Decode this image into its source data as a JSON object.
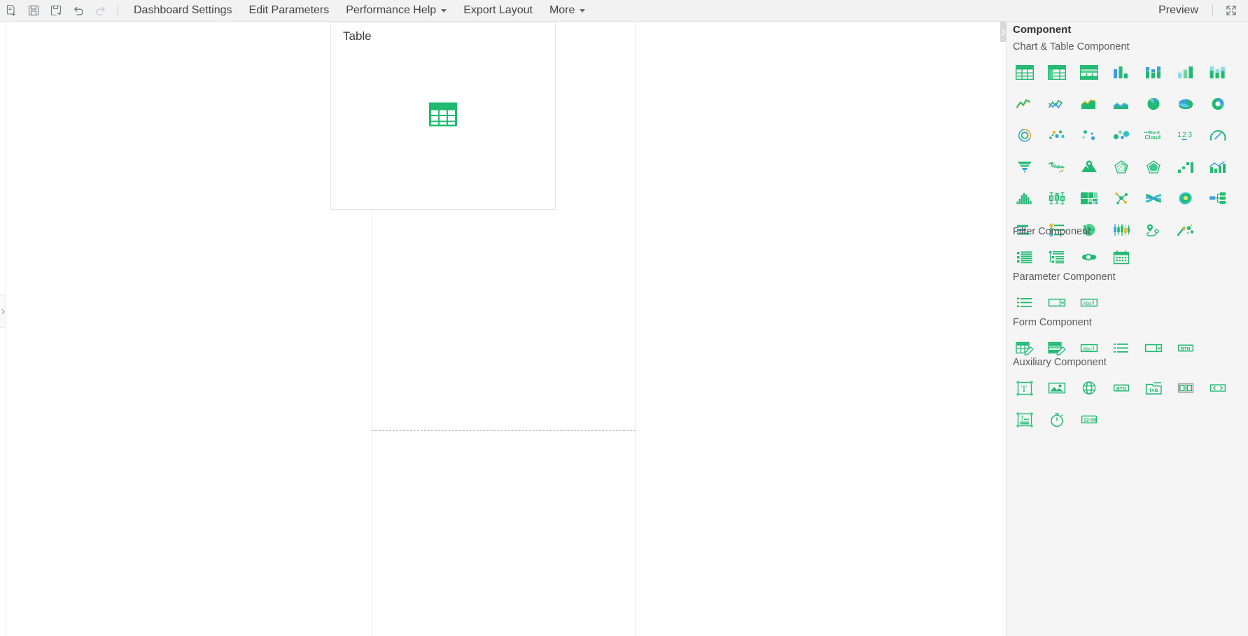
{
  "toolbar": {
    "icons": [
      {
        "name": "new-dashboard-icon",
        "title": "New"
      },
      {
        "name": "save-icon",
        "title": "Save"
      },
      {
        "name": "save-as-icon",
        "title": "Save As"
      },
      {
        "name": "undo-icon",
        "title": "Undo"
      },
      {
        "name": "redo-icon",
        "title": "Redo"
      }
    ],
    "menus": [
      {
        "label": "Dashboard Settings",
        "caret": false
      },
      {
        "label": "Edit Parameters",
        "caret": false
      },
      {
        "label": "Performance Help",
        "caret": true
      },
      {
        "label": "Export Layout",
        "caret": false
      },
      {
        "label": "More",
        "caret": true
      }
    ],
    "preview_label": "Preview",
    "fullscreen_icon": "fullscreen-icon"
  },
  "canvas": {
    "widget": {
      "title": "Table",
      "placeholder_icon": "table-placeholder-icon"
    }
  },
  "panel": {
    "title": "Component",
    "collapse_icon": "chevron-right-icon",
    "sections": [
      {
        "id": "chart",
        "title": "Chart & Table Component",
        "items": [
          {
            "name": "table-icon",
            "label": "Table"
          },
          {
            "name": "cross-table-icon",
            "label": "Cross Table"
          },
          {
            "name": "group-table-icon",
            "label": "Group Table"
          },
          {
            "name": "column-chart-icon",
            "label": "Column Chart"
          },
          {
            "name": "stacked-column-chart-icon",
            "label": "Stacked Column Chart"
          },
          {
            "name": "column-3d-chart-icon",
            "label": "3D Column Chart"
          },
          {
            "name": "stacked-column-3d-chart-icon",
            "label": "3D Stacked Column Chart"
          },
          {
            "name": "line-chart-icon",
            "label": "Line Chart"
          },
          {
            "name": "multi-line-chart-icon",
            "label": "Multi Line Chart"
          },
          {
            "name": "area-chart-icon",
            "label": "Area Chart"
          },
          {
            "name": "stacked-area-chart-icon",
            "label": "Stacked Area Chart"
          },
          {
            "name": "pie-chart-icon",
            "label": "Pie Chart"
          },
          {
            "name": "pie-3d-chart-icon",
            "label": "3D Pie Chart"
          },
          {
            "name": "donut-chart-icon",
            "label": "Donut Chart"
          },
          {
            "name": "ring-progress-icon",
            "label": "Ring Progress"
          },
          {
            "name": "scatter-chart-icon",
            "label": "Scatter Chart"
          },
          {
            "name": "bubble-chart-icon",
            "label": "Bubble Chart"
          },
          {
            "name": "packed-bubble-icon",
            "label": "Packed Bubble"
          },
          {
            "name": "word-cloud-icon",
            "label": "Word Cloud"
          },
          {
            "name": "kpi-number-icon",
            "label": "KPI Number"
          },
          {
            "name": "gauge-chart-icon",
            "label": "Gauge Chart"
          },
          {
            "name": "funnel-chart-icon",
            "label": "Funnel Chart"
          },
          {
            "name": "world-map-icon",
            "label": "World Map"
          },
          {
            "name": "point-map-icon",
            "label": "Point Map"
          },
          {
            "name": "radar-chart-icon",
            "label": "Radar Chart"
          },
          {
            "name": "filled-radar-chart-icon",
            "label": "Filled Radar Chart"
          },
          {
            "name": "waterfall-chart-icon",
            "label": "Waterfall Chart"
          },
          {
            "name": "combo-chart-icon",
            "label": "Combo Chart"
          },
          {
            "name": "histogram-icon",
            "label": "Histogram"
          },
          {
            "name": "box-plot-icon",
            "label": "Box Plot"
          },
          {
            "name": "treemap-icon",
            "label": "Treemap"
          },
          {
            "name": "network-chart-icon",
            "label": "Network Chart"
          },
          {
            "name": "sankey-chart-icon",
            "label": "Sankey Chart"
          },
          {
            "name": "contour-map-icon",
            "label": "Contour Map"
          },
          {
            "name": "org-tree-icon",
            "label": "Org Tree"
          },
          {
            "name": "bar-chart-icon",
            "label": "Bar Chart"
          },
          {
            "name": "bullet-chart-icon",
            "label": "Bullet Chart"
          },
          {
            "name": "globe-map-icon",
            "label": "Globe Map"
          },
          {
            "name": "candlestick-chart-icon",
            "label": "Candlestick Chart"
          },
          {
            "name": "route-map-icon",
            "label": "Route Map"
          },
          {
            "name": "custom-chart-icon",
            "label": "Custom Chart"
          }
        ]
      },
      {
        "id": "filter",
        "title": "Filter Component",
        "items": [
          {
            "name": "list-filter-icon",
            "label": "List Filter"
          },
          {
            "name": "tree-filter-icon",
            "label": "Tree Filter"
          },
          {
            "name": "switch-filter-icon",
            "label": "Switch Filter"
          },
          {
            "name": "date-filter-icon",
            "label": "Date Filter"
          }
        ]
      },
      {
        "id": "param",
        "title": "Parameter Component",
        "items": [
          {
            "name": "param-list-icon",
            "label": "Parameter List"
          },
          {
            "name": "param-dropdown-icon",
            "label": "Parameter Dropdown"
          },
          {
            "name": "param-text-icon",
            "label": "Parameter Text"
          }
        ]
      },
      {
        "id": "form",
        "title": "Form Component",
        "items": [
          {
            "name": "form-table-icon",
            "label": "Form Table"
          },
          {
            "name": "form-group-table-icon",
            "label": "Form Group Table"
          },
          {
            "name": "form-text-icon",
            "label": "Form Text"
          },
          {
            "name": "form-list-icon",
            "label": "Form List"
          },
          {
            "name": "form-dropdown-icon",
            "label": "Form Dropdown"
          },
          {
            "name": "form-button-icon",
            "label": "Form Button"
          }
        ]
      },
      {
        "id": "aux",
        "title": "Auxiliary Component",
        "items": [
          {
            "name": "text-box-icon",
            "label": "Text Box"
          },
          {
            "name": "image-icon",
            "label": "Image"
          },
          {
            "name": "web-page-icon",
            "label": "Web Page"
          },
          {
            "name": "button-icon",
            "label": "Button"
          },
          {
            "name": "tab-icon",
            "label": "Tab"
          },
          {
            "name": "carousel-icon",
            "label": "Carousel"
          },
          {
            "name": "pagination-icon",
            "label": "Pagination"
          },
          {
            "name": "rich-text-icon",
            "label": "Rich Text"
          },
          {
            "name": "timer-icon",
            "label": "Timer"
          },
          {
            "name": "clock-icon",
            "label": "Clock"
          }
        ]
      }
    ]
  },
  "colors": {
    "brand_green": "#21ba72",
    "accent_blue": "#3aa0e0",
    "accent_teal": "#2ec3c3",
    "accent_yellow": "#f0b429",
    "panel_bg": "#f5f5f5",
    "toolbar_bg": "#f2f2f2"
  }
}
